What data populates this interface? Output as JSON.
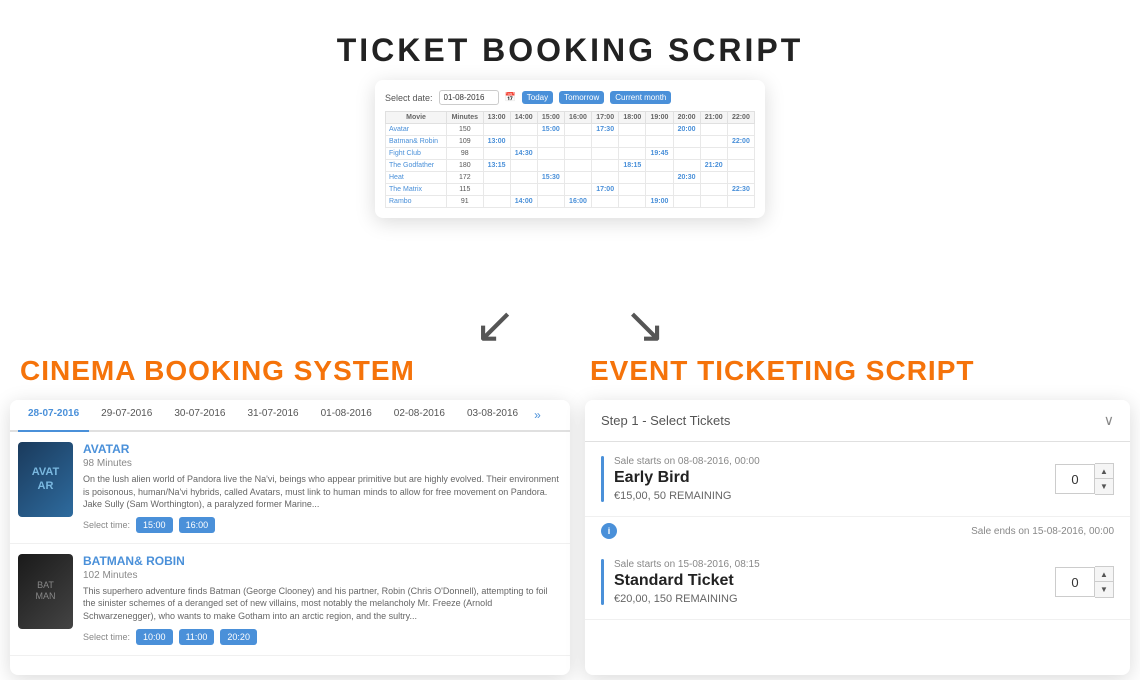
{
  "header": {
    "title": "TICKET BOOKING SCRIPT"
  },
  "center_card": {
    "date_label": "Select date:",
    "date_value": "01-08-2016",
    "btn_today": "Today",
    "btn_tomorrow": "Tomorrow",
    "btn_current_month": "Current month",
    "table": {
      "columns": [
        "Movie",
        "Minutes",
        "13:00",
        "14:00",
        "15:00",
        "16:00",
        "17:00",
        "18:00",
        "19:00",
        "20:00",
        "21:00",
        "22:00"
      ],
      "rows": [
        {
          "movie": "Avatar",
          "minutes": "150",
          "times": {
            "15:00": "15:00",
            "17:30": "17:30",
            "20:00": "20:00"
          }
        },
        {
          "movie": "Batman& Robin",
          "minutes": "109",
          "times": {
            "13:00": "13:00",
            "22:00": "22:00"
          }
        },
        {
          "movie": "Fight Club",
          "minutes": "98",
          "times": {
            "14:30": "14:30",
            "19:45": "19:45"
          }
        },
        {
          "movie": "The Godfather",
          "minutes": "180",
          "times": {
            "13:15": "13:15",
            "18:15": "18:15",
            "21:20": "21:20"
          }
        },
        {
          "movie": "Heat",
          "minutes": "172",
          "times": {
            "15:30": "15:30",
            "20:30": "20:30"
          }
        },
        {
          "movie": "The Matrix",
          "minutes": "115",
          "times": {
            "17:00": "17:00",
            "22:30": "22:30"
          }
        },
        {
          "movie": "Rambo",
          "minutes": "91",
          "times": {
            "14:00": "14:00",
            "16:00": "16:00",
            "19:00": "19:00"
          }
        }
      ]
    }
  },
  "arrows": {
    "left": "↙",
    "right": "↘"
  },
  "cinema_section": {
    "label": "CINEMA BOOKING SYSTEM",
    "dates": [
      "28-07-2016",
      "29-07-2016",
      "30-07-2016",
      "31-07-2016",
      "01-08-2016",
      "02-08-2016",
      "03-08-2016"
    ],
    "active_date_index": 0,
    "movies": [
      {
        "title": "AVATAR",
        "duration": "98 Minutes",
        "description": "On the lush alien world of Pandora live the Na'vi, beings who appear primitive but are highly evolved. Their environment is poisonous, human/Na'vi hybrids, called Avatars, must link to human minds to allow for free movement on Pandora. Jake Sully (Sam Worthington), a paralyzed former Marine...",
        "select_time_label": "Select time:",
        "times": [
          "15:00",
          "16:00"
        ],
        "poster_label": "AVAT\nAR"
      },
      {
        "title": "BATMAN& ROBIN",
        "duration": "102 Minutes",
        "description": "This superhero adventure finds Batman (George Clooney) and his partner, Robin (Chris O'Donnell), attempting to foil the sinister schemes of a deranged set of new villains, most notably the melancholy Mr. Freeze (Arnold Schwarzenegger), who wants to make Gotham into an arctic region, and the sultry...",
        "select_time_label": "Select time:",
        "times": [
          "10:00",
          "11:00",
          "20:20"
        ],
        "poster_label": "BAT\nMAN"
      }
    ]
  },
  "event_section": {
    "label": "EVENT TICKETING SCRIPT",
    "step_label": "Step 1 - Select Tickets",
    "chevron": "∨",
    "tickets": [
      {
        "sale_starts": "Sale starts on 08-08-2016, 00:00",
        "name": "Early Bird",
        "price": "€15,00",
        "remaining": "50 REMAINING",
        "qty": "0",
        "sale_ends": "",
        "info_text": ""
      },
      {
        "sale_starts": "Sale starts on 15-08-2016, 08:15",
        "name": "Standard Ticket",
        "price": "€20,00",
        "remaining": "150 REMAINING",
        "qty": "0",
        "sale_ends": "Sale ends on 15-08-2016, 00:00",
        "info_text": ""
      }
    ]
  }
}
